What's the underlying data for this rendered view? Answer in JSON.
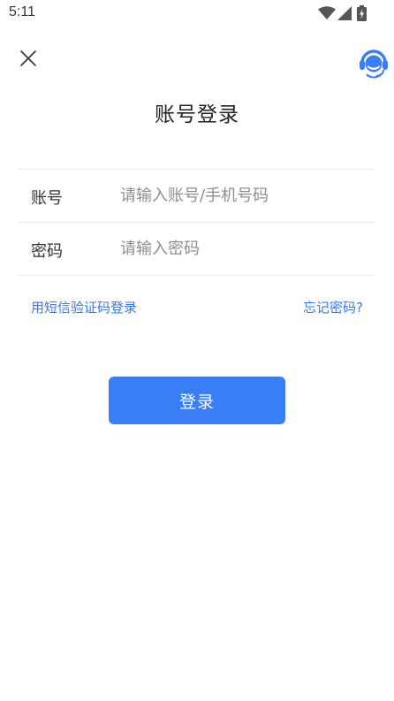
{
  "status_bar": {
    "time": "5:11",
    "icons": [
      "wifi-icon",
      "cellular-signal-icon",
      "battery-charging-icon"
    ]
  },
  "header": {
    "close_icon": "close-icon",
    "support_icon": "customer-service-icon"
  },
  "title": "账号登录",
  "form": {
    "account": {
      "label": "账号",
      "placeholder": "请输入账号/手机号码",
      "value": ""
    },
    "password": {
      "label": "密码",
      "placeholder": "请输入密码",
      "value": ""
    }
  },
  "links": {
    "sms_login": "用短信验证码登录",
    "forgot_password": "忘记密码?"
  },
  "login_button": "登录",
  "colors": {
    "accent": "#3a7ef7",
    "link": "#3578f1",
    "divider": "#ececec",
    "placeholder": "#8e8e8e"
  }
}
